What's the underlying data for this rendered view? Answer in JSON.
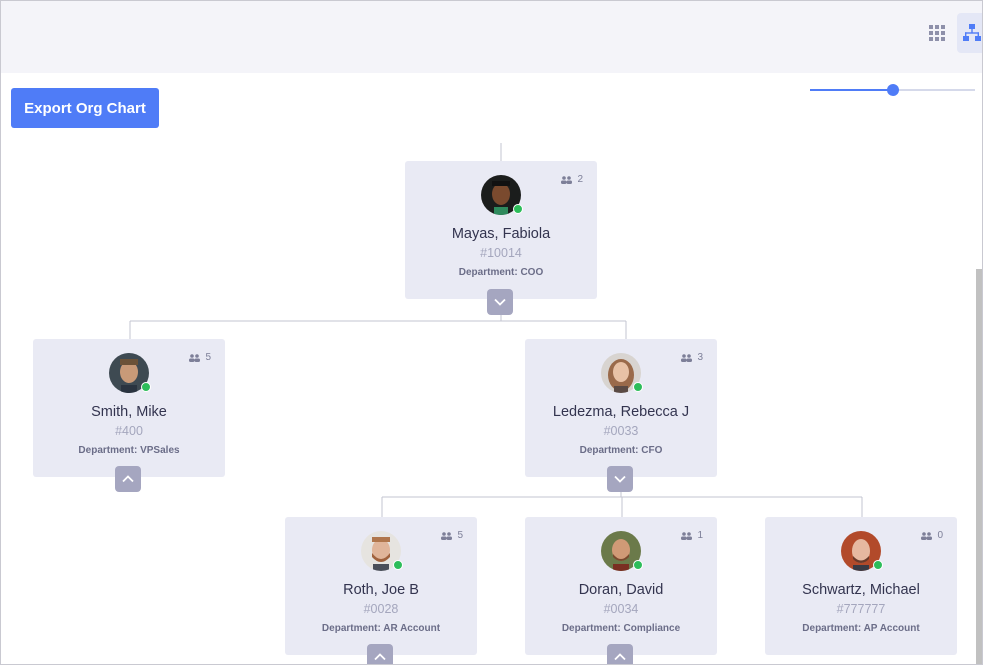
{
  "toolbar": {
    "export_label": "Export Org Chart",
    "grid_view_icon": "grid-icon",
    "tree_view_icon": "org-tree-icon",
    "zoom_level_fraction": 0.5
  },
  "colors": {
    "accent": "#4f7cf7",
    "card_bg": "#e9eaf4",
    "toggle_bg": "#a5a6c0",
    "online": "#2dbd5a"
  },
  "nodes": [
    {
      "id": "fabiola",
      "name": "Mayas, Fabiola",
      "empid": "#10014",
      "dept": "Department: COO",
      "reports": "2",
      "toggle": "collapse",
      "avatar": "male-dark-portrait"
    },
    {
      "id": "mike",
      "name": "Smith, Mike",
      "empid": "#400",
      "dept": "Department: VPSales",
      "reports": "5",
      "toggle": "expand",
      "avatar": "male-portrait"
    },
    {
      "id": "rebecca",
      "name": "Ledezma, Rebecca J",
      "empid": "#0033",
      "dept": "Department: CFO",
      "reports": "3",
      "toggle": "collapse",
      "avatar": "female-portrait"
    },
    {
      "id": "joe",
      "name": "Roth, Joe B",
      "empid": "#0028",
      "dept": "Department: AR Account",
      "reports": "5",
      "toggle": "expand",
      "avatar": "male-bearded-portrait"
    },
    {
      "id": "david",
      "name": "Doran, David",
      "empid": "#0034",
      "dept": "Department: Compliance",
      "reports": "1",
      "toggle": "expand",
      "avatar": "male-bald-portrait"
    },
    {
      "id": "michael",
      "name": "Schwartz, Michael",
      "empid": "#777777",
      "dept": "Department: AP Account",
      "reports": "0",
      "toggle": "none",
      "avatar": "male-glasses-portrait"
    }
  ]
}
